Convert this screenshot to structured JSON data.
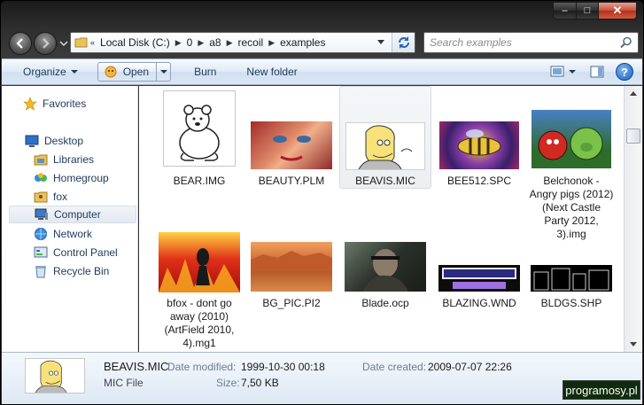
{
  "window": {
    "caption_minimize": "–",
    "caption_maximize": "□",
    "caption_close": "✕"
  },
  "address_bar": {
    "crumbs": [
      "Local Disk (C:)",
      "0",
      "a8",
      "recoil",
      "examples"
    ],
    "search_placeholder": "Search examples"
  },
  "toolbar": {
    "organize": "Organize",
    "open": "Open",
    "burn": "Burn",
    "new_folder": "New folder",
    "help": "?"
  },
  "nav_pane": {
    "items": [
      {
        "label": "Favorites",
        "icon": "star-icon"
      },
      {
        "label": "Desktop",
        "icon": "desktop-icon"
      },
      {
        "label": "Libraries",
        "icon": "libraries-icon"
      },
      {
        "label": "Homegroup",
        "icon": "homegroup-icon"
      },
      {
        "label": "fox",
        "icon": "user-folder-icon"
      },
      {
        "label": "Computer",
        "icon": "computer-icon",
        "selected": true
      },
      {
        "label": "Network",
        "icon": "network-icon"
      },
      {
        "label": "Control Panel",
        "icon": "control-panel-icon"
      },
      {
        "label": "Recycle Bin",
        "icon": "recycle-bin-icon"
      }
    ]
  },
  "files": [
    {
      "name": "BEAR.IMG",
      "thumb_colors": [
        "#ffffff",
        "#444444"
      ]
    },
    {
      "name": "BEAUTY.PLM",
      "thumb_colors": [
        "#c73a3a",
        "#e8a07a"
      ]
    },
    {
      "name": "BEAVIS.MIC",
      "thumb_colors": [
        "#f4e08a",
        "#2d2d2d"
      ],
      "selected": true
    },
    {
      "name": "BEE512.SPC",
      "thumb_colors": [
        "#6b3fa0",
        "#e0c060"
      ]
    },
    {
      "name": "Belchonok - Angry pigs (2012) (Next Castle Party 2012, 3).img",
      "thumb_colors": [
        "#2f6b2a",
        "#c92a2a"
      ]
    },
    {
      "name": "bfox - dont go away (2010) (ArtField 2010, 4).mg1",
      "thumb_colors": [
        "#d4261a",
        "#f0a020"
      ]
    },
    {
      "name": "BG_PIC.PI2",
      "thumb_colors": [
        "#d0703a",
        "#a04a22"
      ]
    },
    {
      "name": "Blade.ocp",
      "thumb_colors": [
        "#2a2e2a",
        "#7a8a6a"
      ]
    },
    {
      "name": "BLAZING.WND",
      "thumb_colors": [
        "#101010",
        "#d0d0ff"
      ]
    },
    {
      "name": "BLDGS.SHP",
      "thumb_colors": [
        "#000000",
        "#c8c8c8"
      ]
    }
  ],
  "details": {
    "name": "BEAVIS.MIC",
    "type": "MIC File",
    "modified_label": "Date modified:",
    "modified_value": "1999-10-30 00:18",
    "created_label": "Date created:",
    "created_value": "2009-07-07 22:26",
    "size_label": "Size:",
    "size_value": "7,50 KB"
  },
  "watermark": "programosy.pl"
}
